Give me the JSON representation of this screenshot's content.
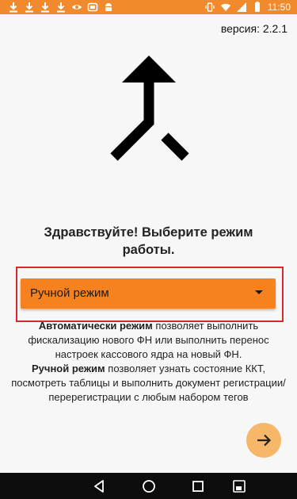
{
  "status_bar": {
    "time": "11:50",
    "notification_icons": [
      "download-icon",
      "download-icon",
      "download-icon",
      "download-icon",
      "eye-icon",
      "screen-icon",
      "android-icon"
    ],
    "system_icons": [
      "vibrate-icon",
      "wifi-icon",
      "signal-icon",
      "battery-icon"
    ]
  },
  "version": "версия: 2.2.1",
  "greeting": "Здравствуйте! Выберите режим работы.",
  "mode_select": {
    "selected": "Ручной режим"
  },
  "description": {
    "auto_title": "Автоматически режим",
    "auto_text": " позволяет выполнить фискализацию нового ФН или выполнить перенос настроек кассового ядра на новый ФН.",
    "manual_title": "Ручной режим",
    "manual_text": " позволяет узнать состояние ККТ, посмотреть таблицы и выполнить документ регистрации/перерегистрации с любым набором тегов"
  },
  "colors": {
    "accent": "#f5821f",
    "status_bar": "#f08a2c",
    "highlight": "#d8272d",
    "fab": "#f7b769"
  }
}
